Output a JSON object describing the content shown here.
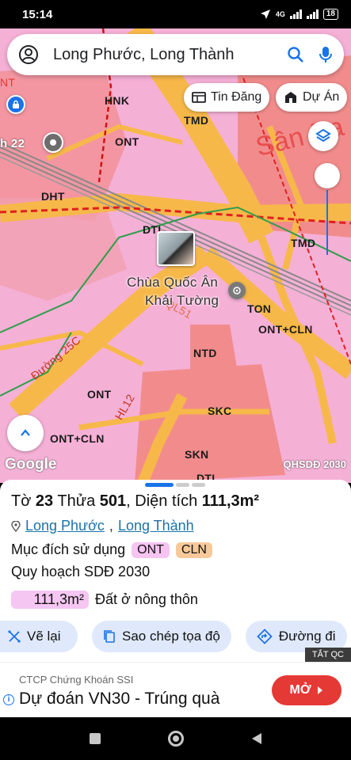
{
  "status": {
    "time": "15:14",
    "network": "4G",
    "battery": "18"
  },
  "search": {
    "query": "Long Phước, Long Thành"
  },
  "chips": {
    "listings": "Tin Đăng",
    "projects": "Dự Án"
  },
  "map": {
    "labels": {
      "hnk": "HNK",
      "tmd1": "TMD",
      "ont1": "ONT",
      "dht": "DHT",
      "dtl1": "DTL",
      "tmd2": "TMD",
      "ton": "TON",
      "ont_cln1": "ONT+CLN",
      "ntd": "NTD",
      "ont2": "ONT",
      "skc": "SKC",
      "ont_cln2": "ONT+CLN",
      "skn": "SKN",
      "dtl2": "DTL",
      "san_bay": "Sân Ba",
      "partial_22": "h 22",
      "partial_nt": "NT",
      "road_25c": "Đường 25C",
      "road_ql51": "QL51",
      "road_hl12": "HL12",
      "place_line1": "Chùa Quốc Ân",
      "place_line2": "Khải Tường"
    },
    "google_logo": "Google",
    "layer_label": "QHSDĐ 2030"
  },
  "parcel": {
    "sheet_label": "Tờ",
    "sheet": "23",
    "plot_label": "Thửa",
    "plot": "501",
    "area_label": "Diện tích",
    "area": "111,3m²",
    "ward": "Long Phước",
    "district": "Long Thành",
    "purpose_label": "Mục đích sử dụng",
    "tags": [
      "ONT",
      "CLN"
    ],
    "plan": "Quy hoạch SDĐ 2030",
    "area_value": "111,3m²",
    "land_type": "Đất ở nông thôn"
  },
  "actions": {
    "redraw": "Vẽ lại",
    "copy_coords": "Sao chép tọa độ",
    "directions": "Đường đi"
  },
  "ad": {
    "close_tag": "TẮT QC",
    "advertiser": "CTCP Chứng Khoán SSI",
    "headline": "Dự đoán VN30 - Trúng quà",
    "cta": "MỞ"
  },
  "colors": {
    "accent": "#1a73e8",
    "rural_land": "#f5b0d6",
    "road": "#f7b84a",
    "ad_cta": "#e53935"
  }
}
